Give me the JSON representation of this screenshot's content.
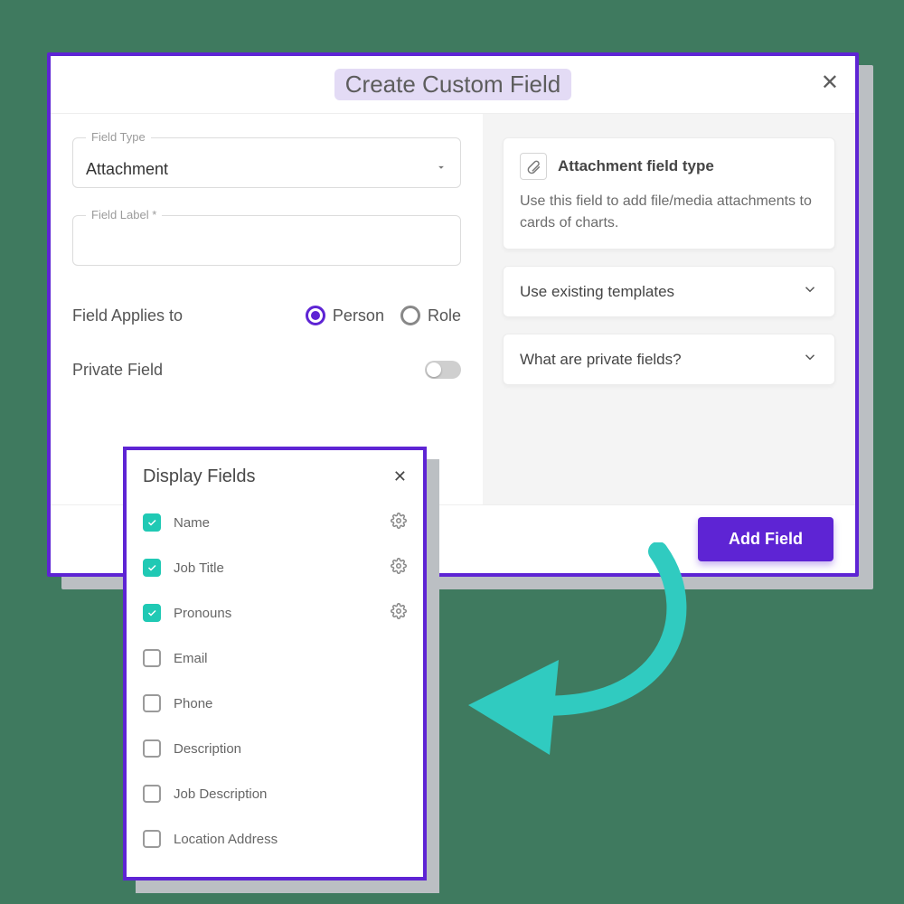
{
  "modal": {
    "title": "Create Custom Field",
    "field_type_floating_label": "Field Type",
    "field_type_value": "Attachment",
    "field_label_floating_label": "Field Label *",
    "field_label_value": "",
    "applies_to_label": "Field Applies to",
    "applies_options": {
      "person": "Person",
      "role": "Role"
    },
    "applies_selected": "person",
    "private_label": "Private Field",
    "private_on": false,
    "primary_button": "Add Field"
  },
  "info": {
    "heading": "Attachment field type",
    "description": "Use this field to add file/media attachments to cards of charts.",
    "expanders": [
      "Use existing templates",
      "What are private fields?"
    ]
  },
  "display_panel": {
    "title": "Display Fields",
    "items": [
      {
        "label": "Name",
        "checked": true,
        "gear": true
      },
      {
        "label": "Job Title",
        "checked": true,
        "gear": true
      },
      {
        "label": "Pronouns",
        "checked": true,
        "gear": true
      },
      {
        "label": "Email",
        "checked": false,
        "gear": false
      },
      {
        "label": "Phone",
        "checked": false,
        "gear": false
      },
      {
        "label": "Description",
        "checked": false,
        "gear": false
      },
      {
        "label": "Job Description",
        "checked": false,
        "gear": false
      },
      {
        "label": "Location Address",
        "checked": false,
        "gear": false
      }
    ]
  }
}
